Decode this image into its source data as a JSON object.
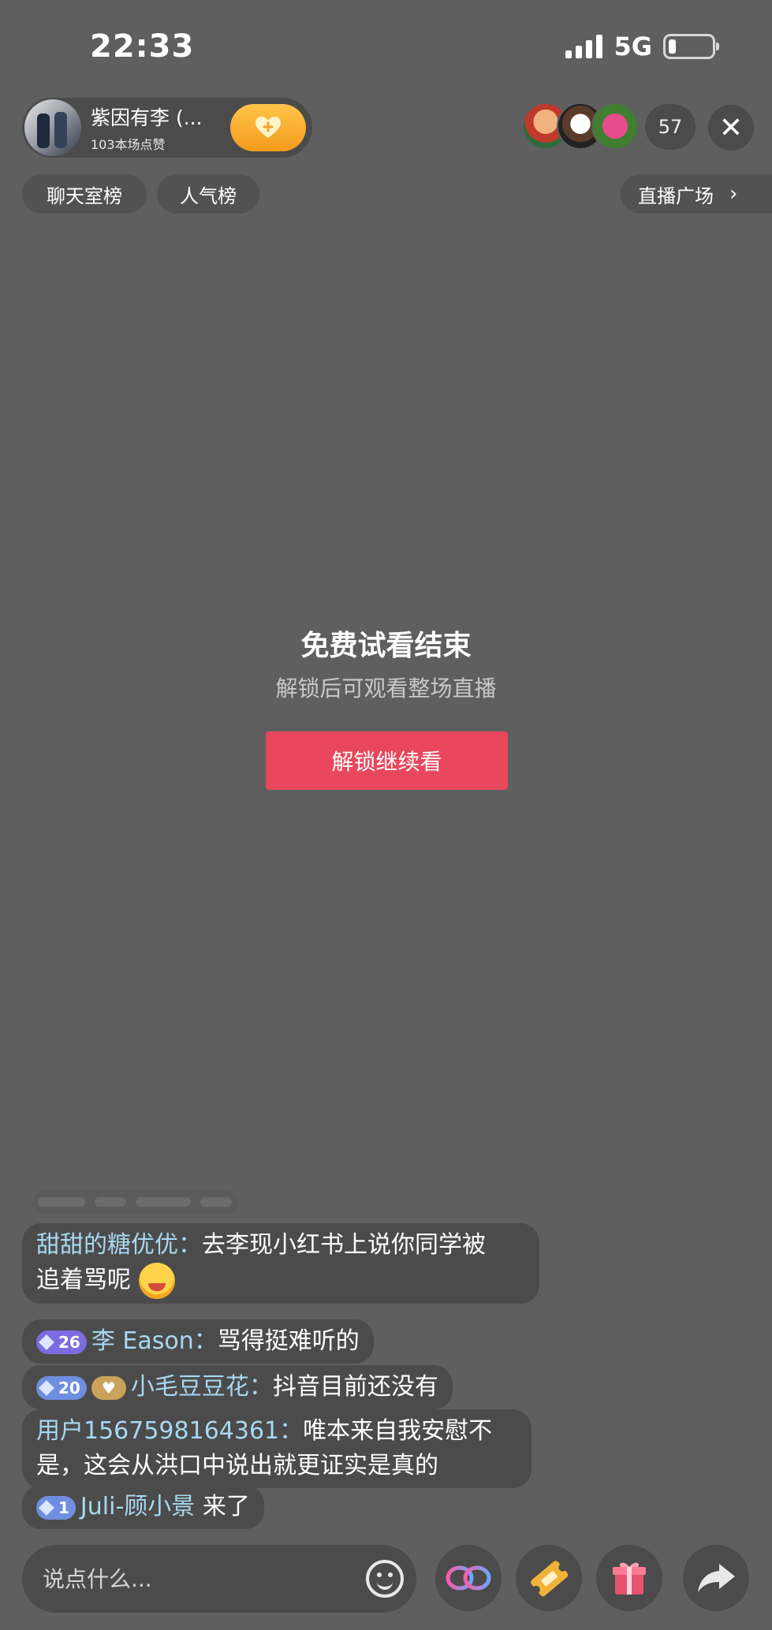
{
  "status_bar": {
    "time": "22:33",
    "network": "5G"
  },
  "host": {
    "name": "紫因有李 (...",
    "likes": "103本场点赞"
  },
  "viewer_count": "57",
  "close_label": "✕",
  "rank_tabs": [
    "聊天室榜",
    "人气榜"
  ],
  "plaza": {
    "label": "直播广场",
    "chevron": "›"
  },
  "notice": {
    "title": "免费试看结束",
    "subtitle": "解锁后可观看整场直播",
    "button": "解锁继续看"
  },
  "chat": [
    {
      "user": "甜甜的糖优优：",
      "line1": "去李现小红书上说你同学被",
      "line2": "追着骂呢"
    },
    {
      "level": "26",
      "user": "李 Eason：",
      "text": "骂得挺难听的"
    },
    {
      "level": "20",
      "user": "小毛豆豆花：",
      "text": "抖音目前还没有"
    },
    {
      "user": "用户1567598164361：",
      "line1": "唯本来自我安慰不",
      "line2": "是，这会从洪口中说出就更证实是真的"
    },
    {
      "level": "1",
      "user": "Juli-顾小景",
      "text": "来了"
    }
  ],
  "input": {
    "placeholder": "说点什么..."
  },
  "colors": {
    "background": "#5f5f5f",
    "unlock_button": "#e9475c",
    "nickname": "#a8d8f0"
  },
  "icons": [
    "signal-icon",
    "battery-icon",
    "heart-plus-icon",
    "close-icon",
    "chevron-right-icon",
    "smile-icon",
    "link-icon",
    "ticket-icon",
    "gift-icon",
    "share-icon"
  ]
}
